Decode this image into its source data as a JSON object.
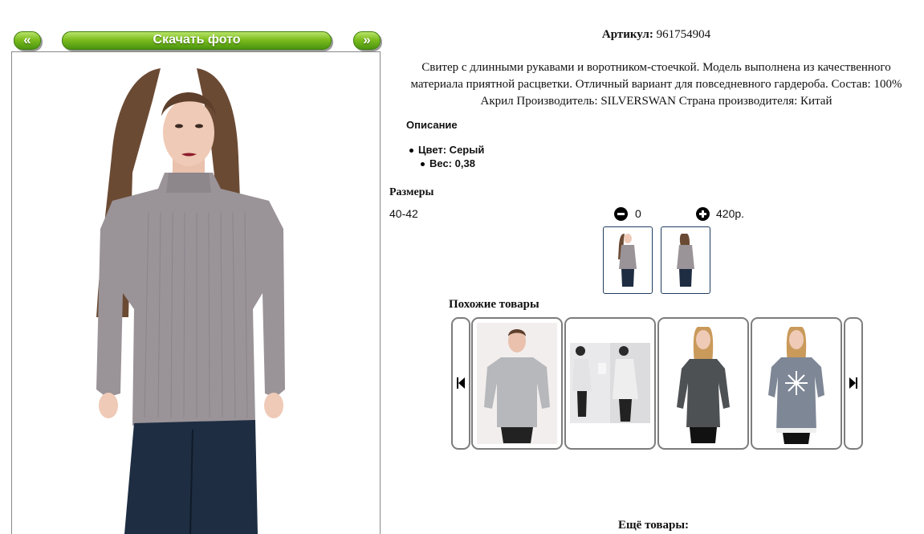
{
  "nav": {
    "prev_label": "«",
    "download_label": "Скачать фото",
    "next_label": "»"
  },
  "product": {
    "article_label": "Артикул:",
    "article_value": "961754904",
    "description_line1": "Свитер с длинными рукавами и воротником-стоечкой. Модель выполнена из качественного",
    "description_line2": "материала приятной расцветки. Отличный вариант для повседневного гардероба. Состав: 100%",
    "description_line3": "Акрил Производитель: SILVERSWAN Страна производителя: Китай",
    "description_heading": "Описание",
    "properties": [
      "Цвет: Серый",
      "Вес: 0,38"
    ]
  },
  "sizes": {
    "heading": "Размеры",
    "rows": [
      {
        "size": "40-42",
        "quantity": "0",
        "price": "420р."
      }
    ]
  },
  "similar": {
    "heading": "Похожие товары",
    "items": [
      {
        "icon": "sweater-photo",
        "color": "#b6b8bb"
      },
      {
        "icon": "collage-photo",
        "color": "#e3e3e5"
      },
      {
        "icon": "tunic-photo",
        "color": "#4e5154"
      },
      {
        "icon": "snowflake-sweater-photo",
        "color": "#7e8796"
      }
    ]
  },
  "footer_cut_text": "Ещё товары:",
  "colors": {
    "accent_green": "#6aae18",
    "sweater": "#9a9398",
    "border": "#7d7d7d"
  }
}
